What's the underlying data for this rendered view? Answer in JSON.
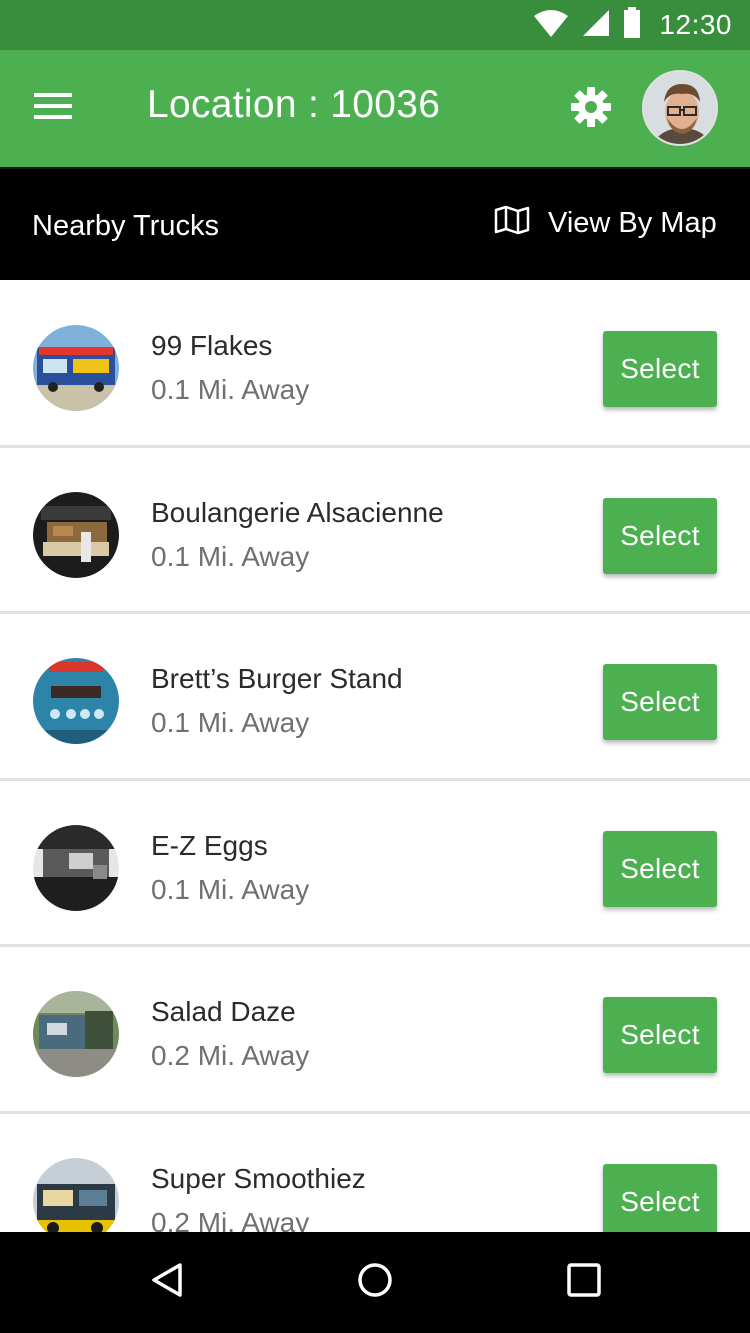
{
  "status_bar": {
    "time": "12:30",
    "icons": [
      "wifi-icon",
      "cell-signal-icon",
      "battery-icon"
    ]
  },
  "app_bar": {
    "title": "Location : 10036",
    "icons": [
      "menu-icon",
      "gear-icon",
      "avatar"
    ]
  },
  "sub_header": {
    "title": "Nearby Trucks",
    "map_link_label": "View By Map",
    "map_icon": "map-icon"
  },
  "trucks": [
    {
      "name": "99 Flakes",
      "distance": "0.1 Mi. Away",
      "select_label": "Select"
    },
    {
      "name": "Boulangerie Alsacienne",
      "distance": "0.1 Mi. Away",
      "select_label": "Select"
    },
    {
      "name": "Brett’s Burger Stand",
      "distance": "0.1 Mi. Away",
      "select_label": "Select"
    },
    {
      "name": "E-Z Eggs",
      "distance": "0.1 Mi. Away",
      "select_label": "Select"
    },
    {
      "name": "Salad Daze",
      "distance": "0.2 Mi. Away",
      "select_label": "Select"
    },
    {
      "name": "Super Smoothiez",
      "distance": "0.2 Mi. Away",
      "select_label": "Select"
    }
  ],
  "nav_bar": {
    "icons": [
      "back-icon",
      "home-icon",
      "recents-icon"
    ]
  },
  "colors": {
    "status_bar": "#388e3c",
    "app_bar": "#4caf50",
    "sub_header": "#000000",
    "button": "#4caf50",
    "nav_bar": "#000000"
  }
}
